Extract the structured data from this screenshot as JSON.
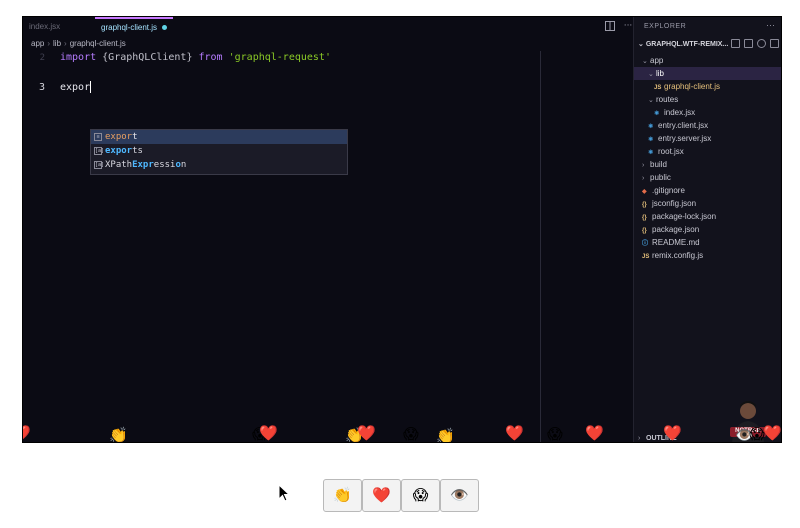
{
  "tabs": [
    {
      "label": "index.jsx",
      "active": false
    },
    {
      "label": "graphql-client.js",
      "active": true,
      "modified": true
    }
  ],
  "breadcrumb": [
    "app",
    "lib",
    "graphql-client.js"
  ],
  "editor": {
    "lines": [
      {
        "num": "2",
        "tokens": [
          "import",
          " {",
          "GraphQLClient",
          "} ",
          "from",
          " 'graphql-request'"
        ]
      },
      {
        "num": "3",
        "text": "expor"
      }
    ],
    "suggestions": [
      {
        "icon": "keyword-icon",
        "match": "expor",
        "rest": "t"
      },
      {
        "icon": "snippet-icon",
        "match": "expor",
        "rest": "ts"
      },
      {
        "icon": "snippet-icon",
        "prefix": "XPath",
        "match": "Expr",
        "rest": "essi",
        "tail": "o",
        "end": "n"
      }
    ]
  },
  "explorer": {
    "title": "EXPLORER",
    "project": "GRAPHQL.WTF-REMIX...",
    "items": [
      {
        "label": "app",
        "type": "folder-open",
        "depth": 1
      },
      {
        "label": "lib",
        "type": "folder-open",
        "depth": 2,
        "selected": true
      },
      {
        "label": "graphql-client.js",
        "type": "js",
        "depth": 3,
        "active": true
      },
      {
        "label": "routes",
        "type": "folder-open",
        "depth": 2
      },
      {
        "label": "index.jsx",
        "type": "react",
        "depth": 3
      },
      {
        "label": "entry.client.jsx",
        "type": "react",
        "depth": 2
      },
      {
        "label": "entry.server.jsx",
        "type": "react",
        "depth": 2
      },
      {
        "label": "root.jsx",
        "type": "react",
        "depth": 2
      },
      {
        "label": "build",
        "type": "folder",
        "depth": 1
      },
      {
        "label": "public",
        "type": "folder",
        "depth": 1
      },
      {
        "label": ".gitignore",
        "type": "git",
        "depth": 1
      },
      {
        "label": "jsconfig.json",
        "type": "json",
        "depth": 1
      },
      {
        "label": "package-lock.json",
        "type": "json",
        "depth": 1
      },
      {
        "label": "package.json",
        "type": "json",
        "depth": 1
      },
      {
        "label": "README.md",
        "type": "info",
        "depth": 1
      },
      {
        "label": "remix.config.js",
        "type": "js",
        "depth": 1
      }
    ],
    "outline_label": "OUTLINE"
  },
  "avatar_label": "NOTRAB",
  "reactions": [
    {
      "name": "clap",
      "glyph": "👏"
    },
    {
      "name": "heart",
      "glyph": "❤️"
    },
    {
      "name": "scream",
      "glyph": "😱"
    },
    {
      "name": "eye",
      "glyph": "👁️"
    }
  ],
  "colors": {
    "editor_bg": "#0b0b14",
    "keyword": "#b67cff",
    "string": "#8ac926",
    "selection": "#2c3b5c",
    "explorer_selection": "#2b2443",
    "tab_active_border": "#c879ff"
  }
}
